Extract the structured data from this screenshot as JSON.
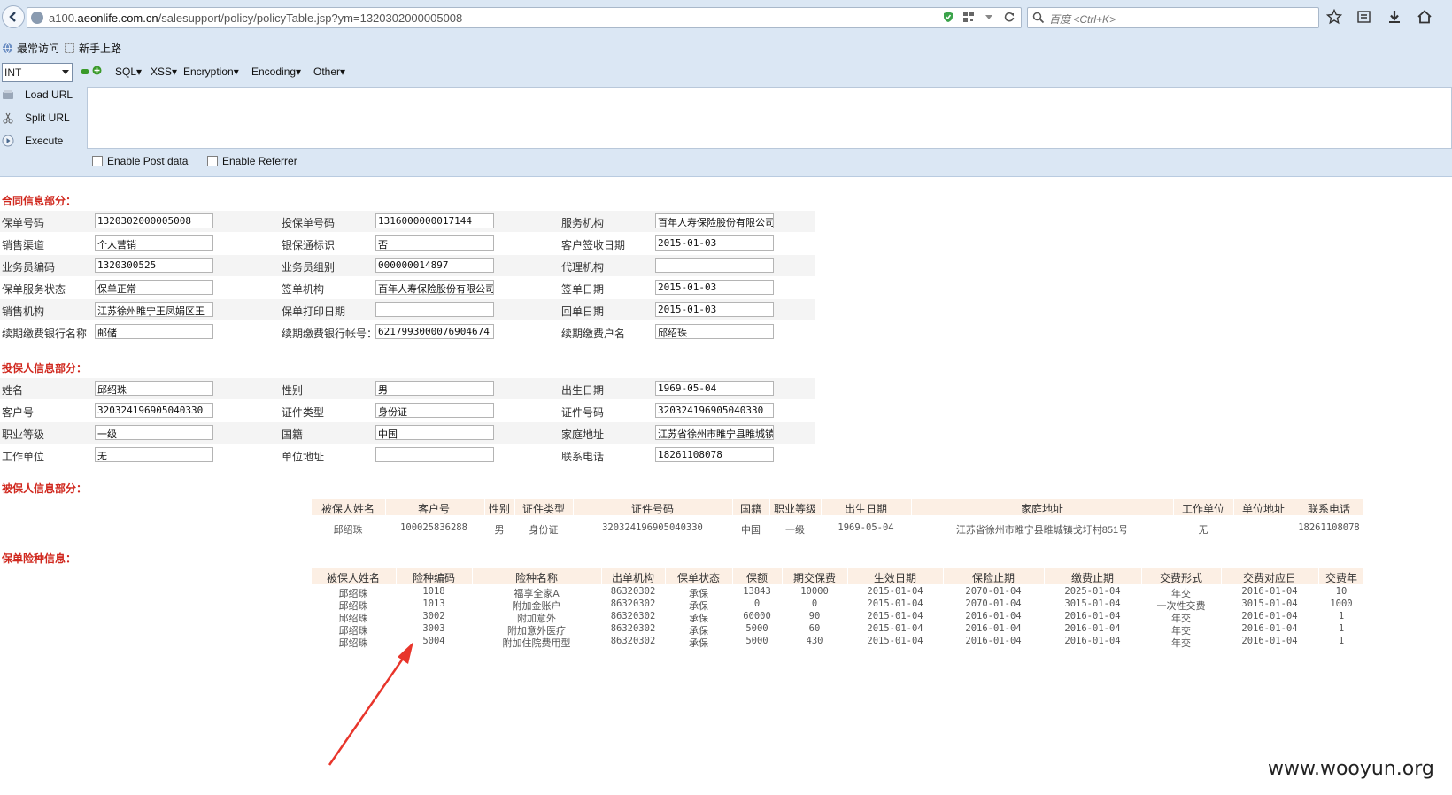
{
  "browser": {
    "url_prefix": "a100.",
    "url_domain": "aeonlife.com.cn",
    "url_path": "/salesupport/policy/policyTable.jsp?ym=1320302000005008",
    "search_placeholder": "百度 <Ctrl+K>"
  },
  "bookmarks": [
    "最常访问",
    "新手上路"
  ],
  "hackbar": {
    "select_value": "INT",
    "menus": [
      "SQL▾",
      "XSS▾",
      "Encryption▾",
      "Encoding▾",
      "Other▾"
    ],
    "buttons": [
      "Load URL",
      "Split URL",
      "Execute"
    ],
    "checkboxes": [
      "Enable Post data",
      "Enable Referrer"
    ]
  },
  "contract": {
    "title": "合同信息部分：",
    "rows": [
      [
        [
          "保单号码",
          "1320302000005008"
        ],
        [
          "投保单号码",
          "1316000000017144"
        ],
        [
          "服务机构",
          "百年人寿保险股份有限公司"
        ]
      ],
      [
        [
          "销售渠道",
          "个人营销"
        ],
        [
          "银保通标识",
          "否"
        ],
        [
          "客户签收日期",
          "2015-01-03"
        ]
      ],
      [
        [
          "业务员编码",
          "1320300525"
        ],
        [
          "业务员组别",
          "000000014897"
        ],
        [
          "代理机构",
          ""
        ]
      ],
      [
        [
          "保单服务状态",
          "保单正常"
        ],
        [
          "签单机构",
          "百年人寿保险股份有限公司"
        ],
        [
          "签单日期",
          "2015-01-03"
        ]
      ],
      [
        [
          "销售机构",
          "江苏徐州睢宁王凤娟区王"
        ],
        [
          "保单打印日期",
          ""
        ],
        [
          "回单日期",
          "2015-01-03"
        ]
      ],
      [
        [
          "续期缴费银行名称",
          "邮储"
        ],
        [
          "续期缴费银行帐号：",
          "6217993000076904674"
        ],
        [
          "续期缴费户名",
          "邱绍珠"
        ]
      ]
    ]
  },
  "applicant": {
    "title": "投保人信息部分：",
    "rows": [
      [
        [
          "姓名",
          "邱绍珠"
        ],
        [
          "性别",
          "男"
        ],
        [
          "出生日期",
          "1969-05-04"
        ]
      ],
      [
        [
          "客户号",
          "320324196905040330"
        ],
        [
          "证件类型",
          "身份证"
        ],
        [
          "证件号码",
          "320324196905040330"
        ]
      ],
      [
        [
          "职业等级",
          "一级"
        ],
        [
          "国籍",
          "中国"
        ],
        [
          "家庭地址",
          "江苏省徐州市睢宁县睢城镇"
        ]
      ],
      [
        [
          "工作单位",
          "无"
        ],
        [
          "单位地址",
          ""
        ],
        [
          "联系电话",
          "18261108078"
        ]
      ]
    ]
  },
  "insured": {
    "title": "被保人信息部分：",
    "headers": [
      "被保人姓名",
      "客户号",
      "性别",
      "证件类型",
      "证件号码",
      "国籍",
      "职业等级",
      "出生日期",
      "家庭地址",
      "工作单位",
      "单位地址",
      "联系电话"
    ],
    "row": [
      "邱绍珠",
      "100025836288",
      "男",
      "身份证",
      "320324196905040330",
      "中国",
      "一级",
      "1969-05-04",
      "江苏省徐州市睢宁县睢城镇戈圩村851号",
      "无",
      "",
      "18261108078"
    ]
  },
  "products": {
    "title": "保单险种信息：",
    "headers": [
      "被保人姓名",
      "险种编码",
      "险种名称",
      "出单机构",
      "保单状态",
      "保额",
      "期交保费",
      "生效日期",
      "保险止期",
      "缴费止期",
      "交费形式",
      "交费对应日",
      "交费年"
    ],
    "rows": [
      [
        "邱绍珠",
        "1018",
        "福享全家A",
        "86320302",
        "承保",
        "13843",
        "10000",
        "2015-01-04",
        "2070-01-04",
        "2025-01-04",
        "年交",
        "2016-01-04",
        "10"
      ],
      [
        "邱绍珠",
        "1013",
        "附加金账户",
        "86320302",
        "承保",
        "0",
        "0",
        "2015-01-04",
        "2070-01-04",
        "3015-01-04",
        "一次性交费",
        "3015-01-04",
        "1000"
      ],
      [
        "邱绍珠",
        "3002",
        "附加意外",
        "86320302",
        "承保",
        "60000",
        "90",
        "2015-01-04",
        "2016-01-04",
        "2016-01-04",
        "年交",
        "2016-01-04",
        "1"
      ],
      [
        "邱绍珠",
        "3003",
        "附加意外医疗",
        "86320302",
        "承保",
        "5000",
        "60",
        "2015-01-04",
        "2016-01-04",
        "2016-01-04",
        "年交",
        "2016-01-04",
        "1"
      ],
      [
        "邱绍珠",
        "5004",
        "附加住院费用型",
        "86320302",
        "承保",
        "5000",
        "430",
        "2015-01-04",
        "2016-01-04",
        "2016-01-04",
        "年交",
        "2016-01-04",
        "1"
      ]
    ]
  },
  "watermark": "www.wooyun.org",
  "colors": {
    "section_title": "#d0281e",
    "table_header_bg": "#fcefe4",
    "chrome_bg": "#dbe7f4",
    "arrow": "#e8352b"
  }
}
